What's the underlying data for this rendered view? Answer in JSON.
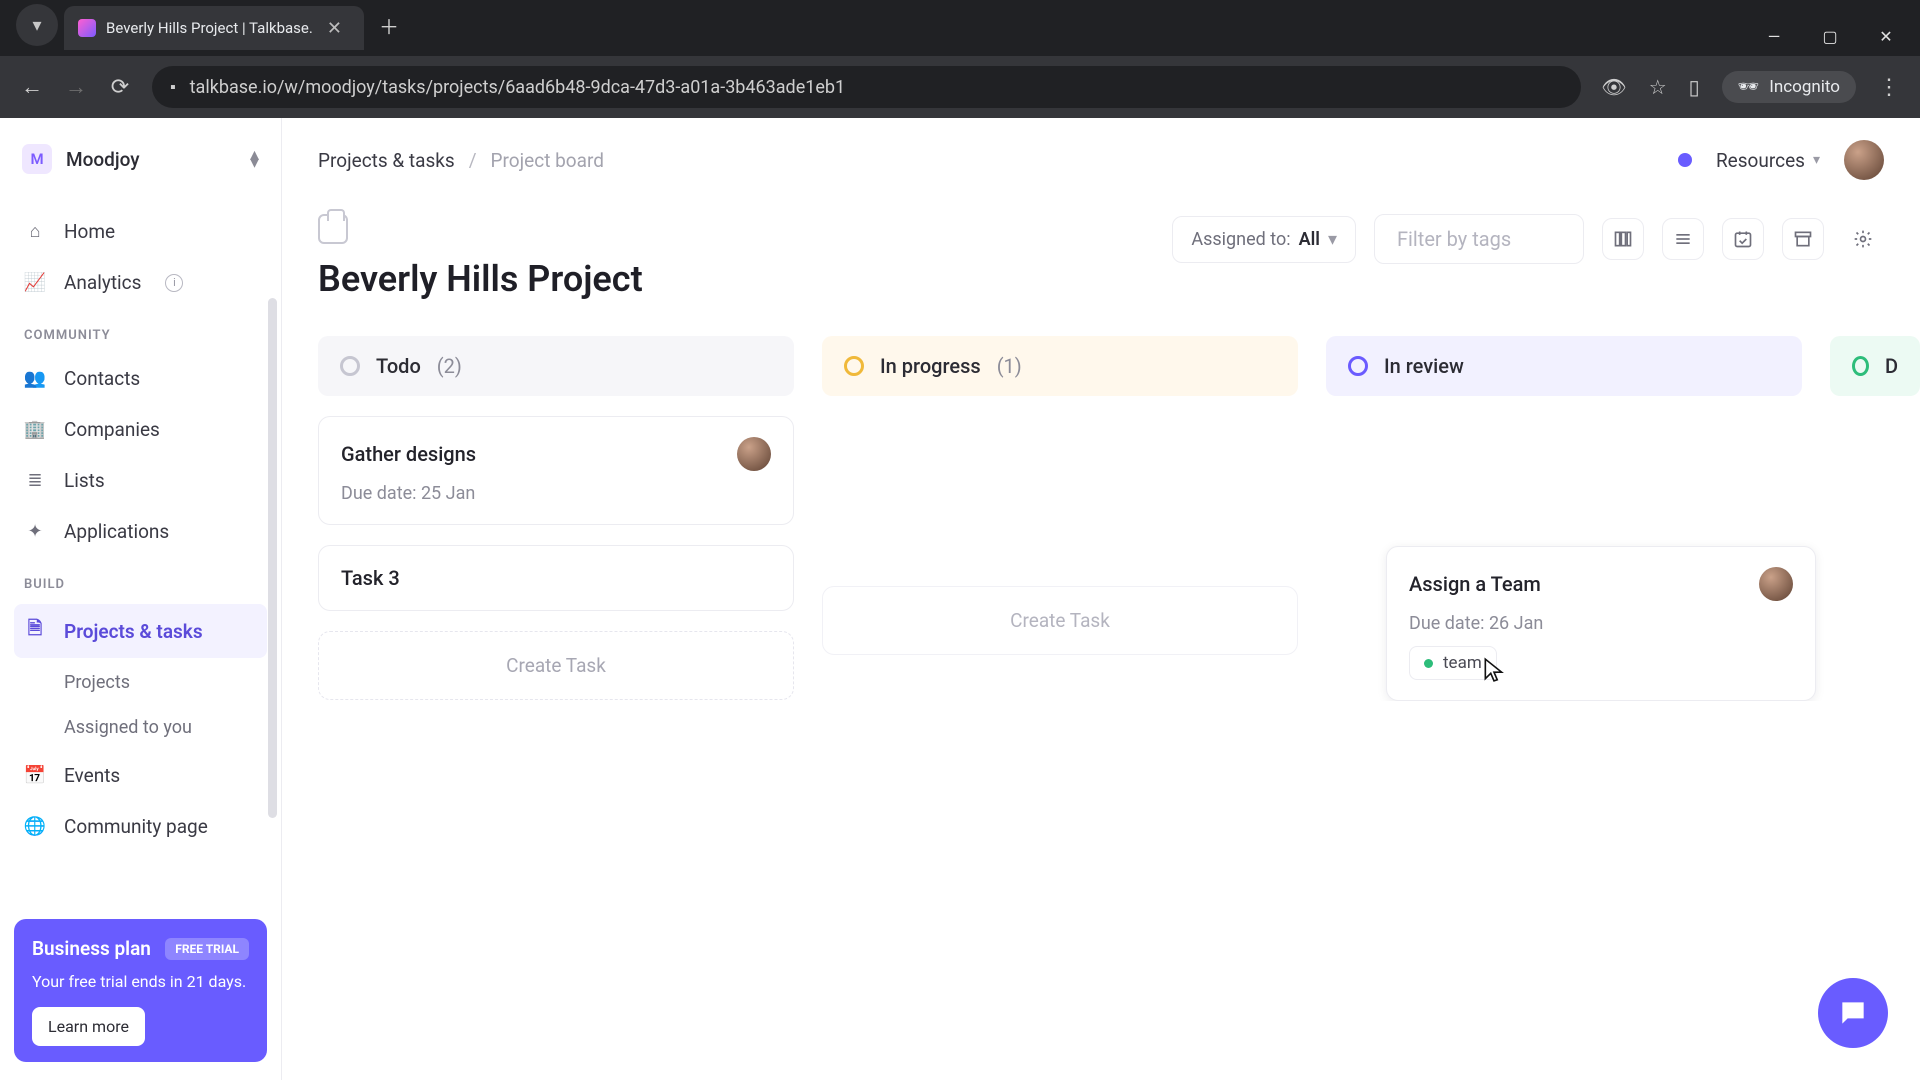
{
  "browser": {
    "tab_title": "Beverly Hills Project | Talkbase.",
    "url": "talkbase.io/w/moodjoy/tasks/projects/6aad6b48-9dca-47d3-a01a-3b463ade1eb1",
    "incognito_label": "Incognito"
  },
  "workspace": {
    "initial": "M",
    "name": "Moodjoy"
  },
  "sidebar": {
    "items": {
      "home": "Home",
      "analytics": "Analytics",
      "contacts": "Contacts",
      "companies": "Companies",
      "lists": "Lists",
      "applications": "Applications",
      "projects_tasks": "Projects & tasks",
      "events": "Events",
      "community_page": "Community page"
    },
    "sub": {
      "projects": "Projects",
      "assigned": "Assigned to you"
    },
    "section_community": "COMMUNITY",
    "section_build": "BUILD"
  },
  "promo": {
    "title": "Business plan",
    "pill": "FREE TRIAL",
    "subtitle": "Your free trial ends in 21 days.",
    "cta": "Learn more"
  },
  "breadcrumb": {
    "a": "Projects & tasks",
    "b": "Project board"
  },
  "topbar": {
    "resources": "Resources"
  },
  "project": {
    "title": "Beverly Hills Project"
  },
  "filters": {
    "assigned_label": "Assigned to:",
    "assigned_value": "All",
    "tags_placeholder": "Filter by tags"
  },
  "columns": {
    "todo": {
      "name": "Todo",
      "count": "(2)"
    },
    "prog": {
      "name": "In progress",
      "count": "(1)"
    },
    "rev": {
      "name": "In review",
      "count": ""
    },
    "done": {
      "name": "D"
    }
  },
  "cards": {
    "todo1": {
      "title": "Gather designs",
      "due": "Due date: 25 Jan"
    },
    "todo2": {
      "title": "Task 3"
    },
    "rev1": {
      "title": "Assign a Team",
      "due": "Due date: 26 Jan",
      "tag": "team"
    }
  },
  "actions": {
    "create_task": "Create Task"
  }
}
